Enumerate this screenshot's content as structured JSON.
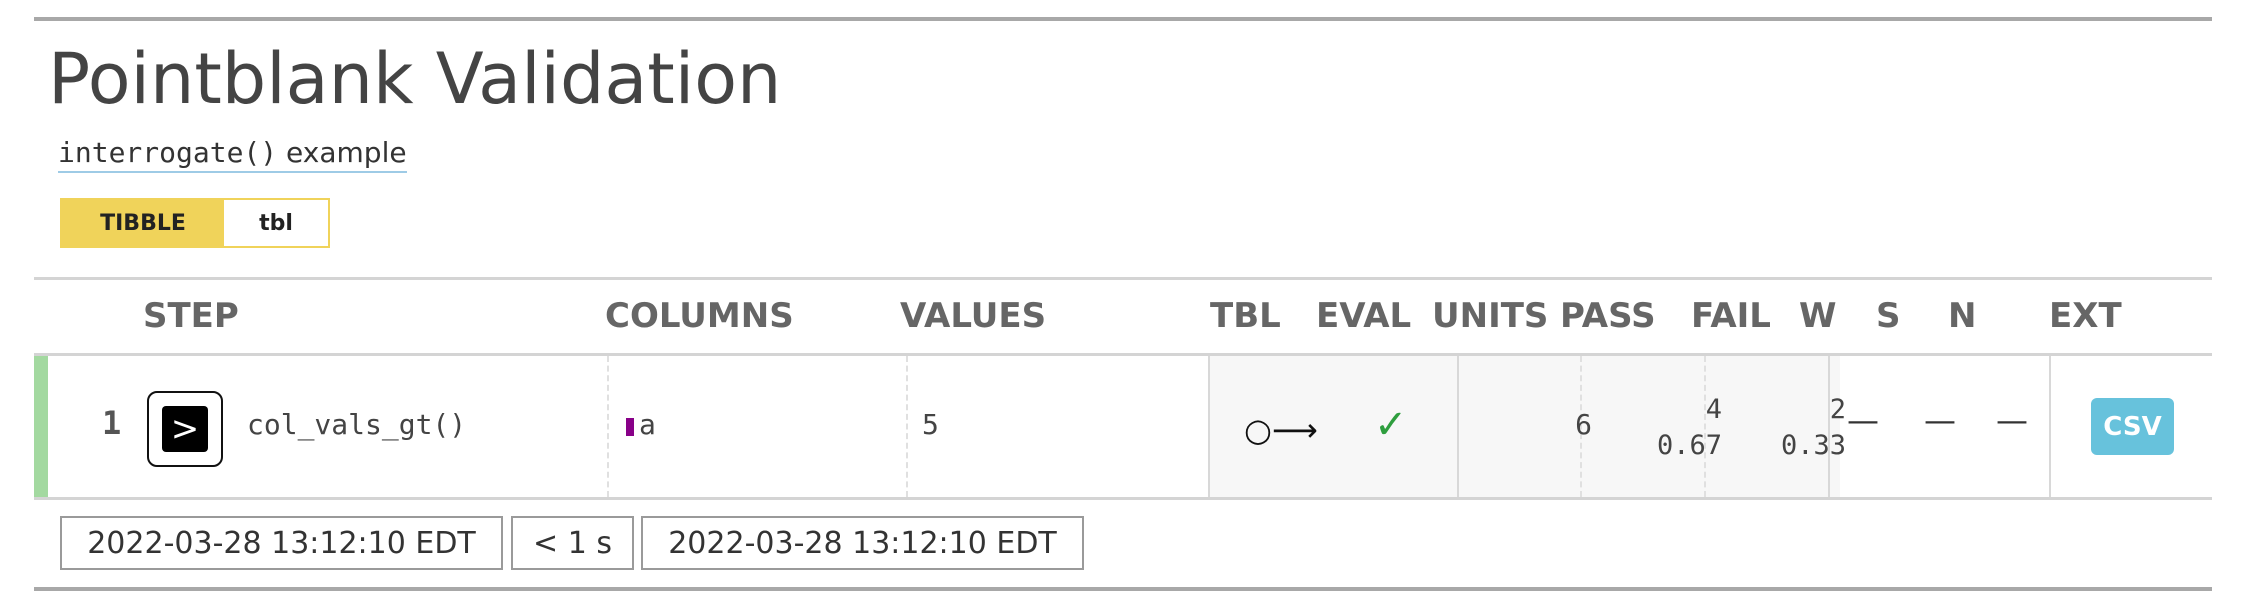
{
  "report": {
    "title": "Pointblank Validation",
    "subtitle_code": "interrogate()",
    "subtitle_text": " example",
    "table_badge": {
      "kind": "TIBBLE",
      "name": "tbl"
    }
  },
  "columns": {
    "step": "STEP",
    "columns": "COLUMNS",
    "values": "VALUES",
    "tbl": "TBL",
    "eval": "EVAL",
    "units": "UNITS",
    "pass": "PASS",
    "fail": "FAIL",
    "w": "W",
    "s": "S",
    "n": "N",
    "ext": "EXT"
  },
  "rows": [
    {
      "step": "1",
      "function": "col_vals_gt()",
      "column": "a",
      "value": "5",
      "tbl_icon": "○⟶",
      "eval_icon": "✓",
      "units": "6",
      "pass_n": "4",
      "pass_f": "0.67",
      "fail_n": "2",
      "fail_f": "0.33",
      "w": "—",
      "s": "—",
      "n": "—",
      "ext": "CSV"
    }
  ],
  "icons": {
    "step_icon": "step-function-icon",
    "tbl_icon": "table-unchanged-arrow-icon",
    "eval_icon": "checkmark-icon"
  },
  "colors": {
    "status_bar": "#a3d9a0",
    "column_chip": "#880088",
    "badge": "#f0d35a",
    "csv_button": "#67c2dc",
    "eval_check": "#2e9e3e"
  },
  "footer": {
    "start_time": "2022-03-28 13:12:10 EDT",
    "duration": "< 1 s",
    "end_time": "2022-03-28 13:12:10 EDT"
  }
}
